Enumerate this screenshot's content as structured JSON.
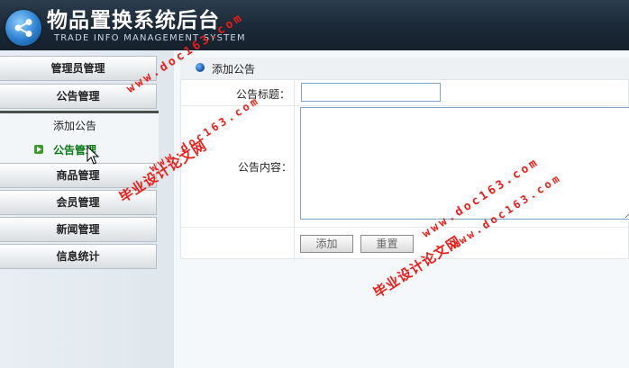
{
  "header": {
    "title": "物品置换系统后台",
    "subtitle": "TRADE INFO MANAGEMENT SYSTEM"
  },
  "leftnav": {
    "items": [
      {
        "label": "管理员管理"
      },
      {
        "label": "公告管理"
      },
      {
        "label": "商品管理"
      },
      {
        "label": "会员管理"
      },
      {
        "label": "新闻管理"
      },
      {
        "label": "信息统计"
      }
    ],
    "submenu": [
      {
        "label": "添加公告",
        "active": false
      },
      {
        "label": "公告管理",
        "active": true
      }
    ]
  },
  "main": {
    "section_title": "添加公告",
    "form": {
      "title_label": "公告标题：",
      "title_value": "",
      "content_label": "公告内容：",
      "content_value": "",
      "add_button": "添加",
      "reset_button": "重置"
    }
  },
  "watermark": {
    "text": "毕业设计论文网",
    "url": "www.doc163.com",
    "color": "#ee1c16"
  }
}
